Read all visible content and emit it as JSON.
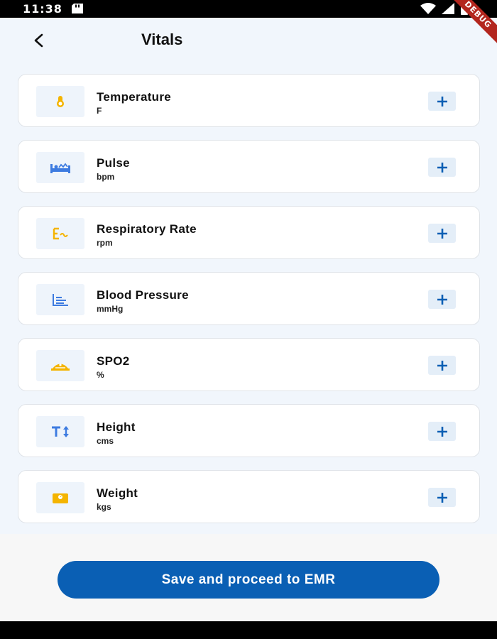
{
  "status_bar": {
    "time": "11:38",
    "debug_label": "DEBUG"
  },
  "header": {
    "title": "Vitals",
    "back_icon": "back-arrow-icon"
  },
  "vitals": [
    {
      "name": "Temperature",
      "unit": "F",
      "icon": "thermometer-icon",
      "icon_color": "#f4b400"
    },
    {
      "name": "Pulse",
      "unit": "bpm",
      "icon": "bed-icon",
      "icon_color": "#3d7be0"
    },
    {
      "name": "Respiratory Rate",
      "unit": "rpm",
      "icon": "breath-icon",
      "icon_color": "#f4b400"
    },
    {
      "name": "Blood Pressure",
      "unit": "mmHg",
      "icon": "chart-icon",
      "icon_color": "#3d7be0"
    },
    {
      "name": "SPO2",
      "unit": "%",
      "icon": "oxygen-icon",
      "icon_color": "#f4b400"
    },
    {
      "name": "Height",
      "unit": "cms",
      "icon": "height-icon",
      "icon_color": "#3d7be0"
    },
    {
      "name": "Weight",
      "unit": "kgs",
      "icon": "scale-icon",
      "icon_color": "#f4b400"
    }
  ],
  "add_icon": "plus-icon",
  "save_button_label": "Save and proceed to EMR",
  "colors": {
    "accent": "#0a5fb4",
    "background": "#f1f6fc",
    "icon_yellow": "#f4b400",
    "icon_blue": "#3d7be0"
  }
}
